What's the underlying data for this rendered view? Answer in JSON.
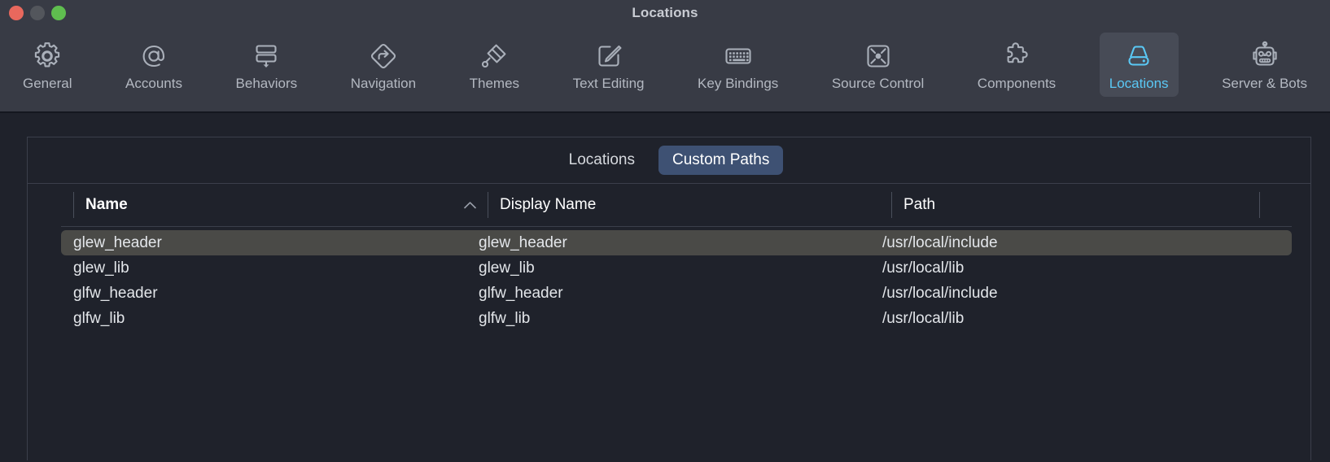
{
  "window": {
    "title": "Locations",
    "controls": [
      {
        "name": "close-button",
        "color": "#e8685d"
      },
      {
        "name": "minimize-button",
        "color": "#53565c"
      },
      {
        "name": "zoom-button",
        "color": "#5fbe4f"
      }
    ]
  },
  "toolbar": {
    "selected": "Locations",
    "accent_color": "#5ac8f5",
    "items": [
      {
        "label": "General",
        "icon": "gear-icon"
      },
      {
        "label": "Accounts",
        "icon": "at-sign-icon"
      },
      {
        "label": "Behaviors",
        "icon": "behaviors-stack-icon"
      },
      {
        "label": "Navigation",
        "icon": "navigation-diamond-arrow-icon"
      },
      {
        "label": "Themes",
        "icon": "paintbrush-icon"
      },
      {
        "label": "Text Editing",
        "icon": "pencil-square-icon"
      },
      {
        "label": "Key Bindings",
        "icon": "keyboard-icon"
      },
      {
        "label": "Source Control",
        "icon": "source-control-icon"
      },
      {
        "label": "Components",
        "icon": "puzzle-piece-icon"
      },
      {
        "label": "Locations",
        "icon": "disk-drive-icon"
      },
      {
        "label": "Server & Bots",
        "icon": "robot-icon"
      }
    ]
  },
  "segmented_control": {
    "options": [
      {
        "label": "Locations",
        "selected": false
      },
      {
        "label": "Custom Paths",
        "selected": true
      }
    ]
  },
  "table": {
    "columns": [
      {
        "label": "Name",
        "sorted": true,
        "sort_direction": "ascending",
        "sort_icon": "chevron-up-icon"
      },
      {
        "label": "Display Name",
        "sorted": false
      },
      {
        "label": "Path",
        "sorted": false
      }
    ],
    "rows": [
      {
        "name": "glew_header",
        "display_name": "glew_header",
        "path": "/usr/local/include",
        "selected": true
      },
      {
        "name": "glew_lib",
        "display_name": "glew_lib",
        "path": "/usr/local/lib",
        "selected": false
      },
      {
        "name": "glfw_header",
        "display_name": "glfw_header",
        "path": "/usr/local/include",
        "selected": false
      },
      {
        "name": "glfw_lib",
        "display_name": "glfw_lib",
        "path": "/usr/local/lib",
        "selected": false
      }
    ]
  }
}
